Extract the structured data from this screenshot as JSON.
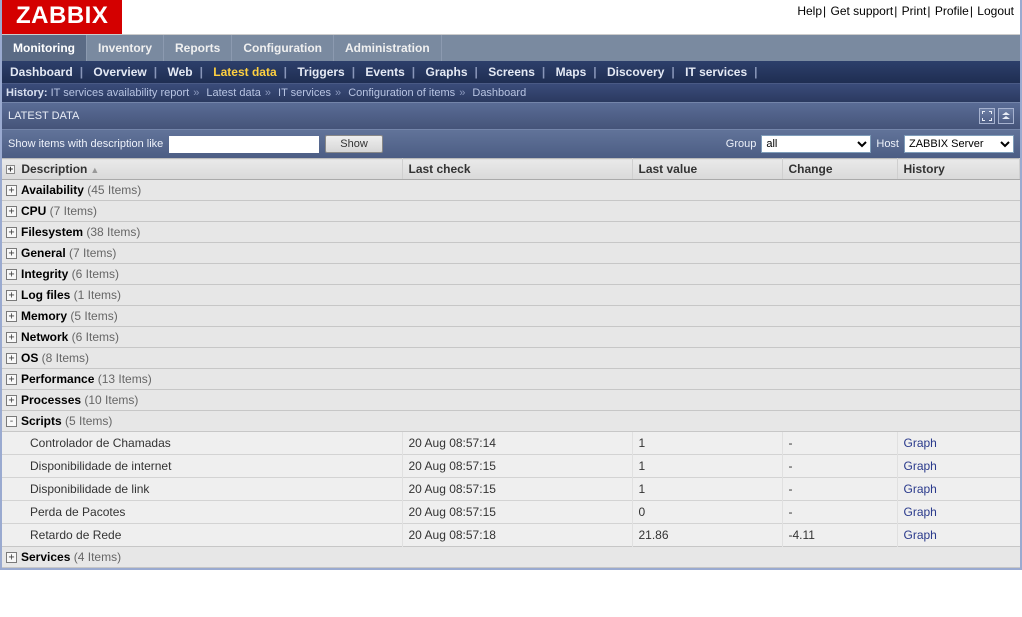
{
  "logo": "ZABBIX",
  "top_links": [
    "Help",
    "Get support",
    "Print",
    "Profile",
    "Logout"
  ],
  "nav1": [
    {
      "label": "Monitoring",
      "active": true
    },
    {
      "label": "Inventory"
    },
    {
      "label": "Reports"
    },
    {
      "label": "Configuration"
    },
    {
      "label": "Administration"
    }
  ],
  "nav2": [
    {
      "label": "Dashboard"
    },
    {
      "label": "Overview"
    },
    {
      "label": "Web"
    },
    {
      "label": "Latest data",
      "current": true
    },
    {
      "label": "Triggers"
    },
    {
      "label": "Events"
    },
    {
      "label": "Graphs"
    },
    {
      "label": "Screens"
    },
    {
      "label": "Maps"
    },
    {
      "label": "Discovery"
    },
    {
      "label": "IT services"
    }
  ],
  "history": {
    "label": "History:",
    "items": [
      "IT services availability report",
      "Latest data",
      "IT services",
      "Configuration of items",
      "Dashboard"
    ]
  },
  "section_title": "LATEST DATA",
  "filter": {
    "desc_label": "Show items with description like",
    "desc_value": "",
    "show_btn": "Show",
    "group_label": "Group",
    "group_value": "all",
    "host_label": "Host",
    "host_value": "ZABBIX Server"
  },
  "columns": {
    "desc": "Description",
    "last_check": "Last check",
    "last_value": "Last value",
    "change": "Change",
    "history": "History"
  },
  "groups": [
    {
      "name": "Availability",
      "count": 45,
      "open": false
    },
    {
      "name": "CPU",
      "count": 7,
      "open": false
    },
    {
      "name": "Filesystem",
      "count": 38,
      "open": false
    },
    {
      "name": "General",
      "count": 7,
      "open": false
    },
    {
      "name": "Integrity",
      "count": 6,
      "open": false
    },
    {
      "name": "Log files",
      "count": 1,
      "open": false
    },
    {
      "name": "Memory",
      "count": 5,
      "open": false
    },
    {
      "name": "Network",
      "count": 6,
      "open": false
    },
    {
      "name": "OS",
      "count": 8,
      "open": false
    },
    {
      "name": "Performance",
      "count": 13,
      "open": false
    },
    {
      "name": "Processes",
      "count": 10,
      "open": false
    },
    {
      "name": "Scripts",
      "count": 5,
      "open": true,
      "items": [
        {
          "desc": "Controlador de Chamadas",
          "check": "20 Aug 08:57:14",
          "value": "1",
          "change": "-",
          "hist": "Graph"
        },
        {
          "desc": "Disponibilidade de internet",
          "check": "20 Aug 08:57:15",
          "value": "1",
          "change": "-",
          "hist": "Graph"
        },
        {
          "desc": "Disponibilidade de link",
          "check": "20 Aug 08:57:15",
          "value": "1",
          "change": "-",
          "hist": "Graph"
        },
        {
          "desc": "Perda de Pacotes",
          "check": "20 Aug 08:57:15",
          "value": "0",
          "change": "-",
          "hist": "Graph"
        },
        {
          "desc": "Retardo de Rede",
          "check": "20 Aug 08:57:18",
          "value": "21.86",
          "change": "-4.11",
          "hist": "Graph"
        }
      ]
    },
    {
      "name": "Services",
      "count": 4,
      "open": false
    }
  ],
  "strings": {
    "items_word": "Items"
  }
}
